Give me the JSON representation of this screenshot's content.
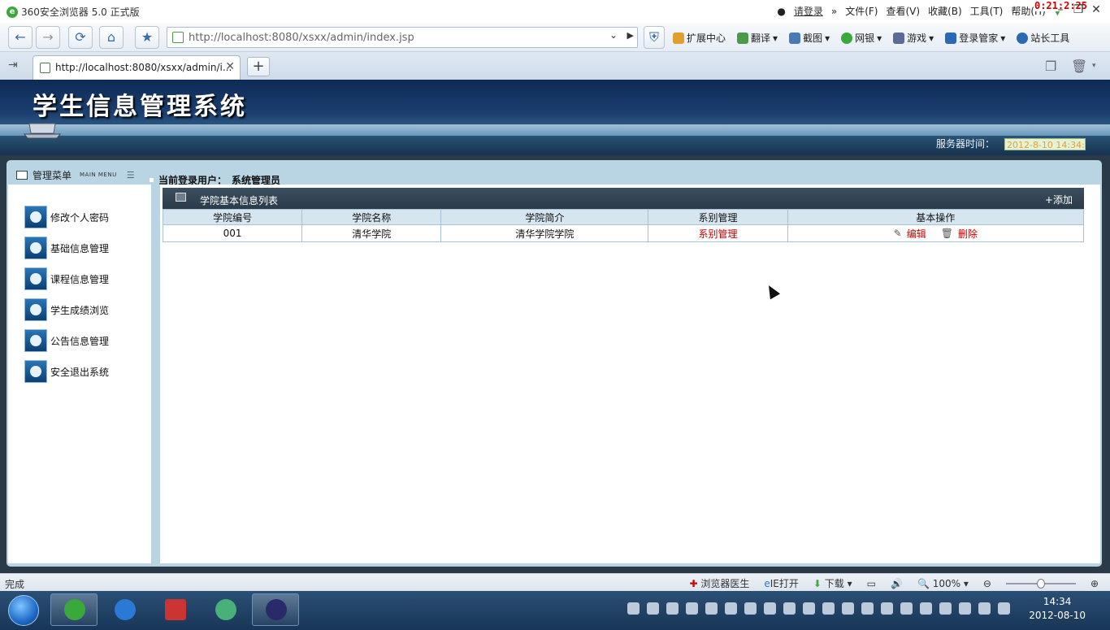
{
  "browser": {
    "window_title": "360安全浏览器 5.0 正式版",
    "login_link": "请登录",
    "menus": [
      "文件(F)",
      "查看(V)",
      "收藏(B)",
      "工具(T)",
      "帮助(H)"
    ],
    "timer": "0:21:2:25",
    "address": "http://localhost:8080/xsxx/admin/index.jsp",
    "tool_items": [
      "扩展中心",
      "翻译",
      "截图",
      "网银",
      "游戏",
      "登录管家",
      "站长工具"
    ],
    "tab_title": "http://localhost:8080/xsxx/admin/i...",
    "status_text": "完成",
    "status_right": [
      "浏览器医生",
      "IE打开",
      "下载",
      "100%"
    ],
    "zoom_percent": 50,
    "clock_time": "14:34",
    "clock_date": "2012-08-10"
  },
  "page": {
    "system_title": "学生信息管理系统",
    "server_time_label": "服务器时间：",
    "server_time": "2012-8-10 14:34:",
    "menu_title": "管理菜单",
    "menu_title_en": "MAIN MENU",
    "current_user_label": "当前登录用户：",
    "current_user": "系统管理员",
    "sidebar": {
      "items": [
        {
          "label": "修改个人密码"
        },
        {
          "label": "基础信息管理"
        },
        {
          "label": "课程信息管理"
        },
        {
          "label": "学生成绩浏览"
        },
        {
          "label": "公告信息管理"
        },
        {
          "label": "安全退出系统"
        }
      ]
    },
    "list": {
      "title": "学院基本信息列表",
      "add_label": "添加",
      "columns": [
        "学院编号",
        "学院名称",
        "学院简介",
        "系别管理",
        "基本操作"
      ],
      "rows": [
        {
          "id": "001",
          "name": "清华学院",
          "intro": "清华学院学院",
          "dept_link": "系别管理",
          "edit": "编辑",
          "delete": "删除"
        }
      ]
    }
  },
  "colors": {
    "banner_dark": "#0d2a55",
    "frame_light": "#b9d5e3",
    "link_red": "#c00000",
    "list_head": "#2a3b4a"
  }
}
